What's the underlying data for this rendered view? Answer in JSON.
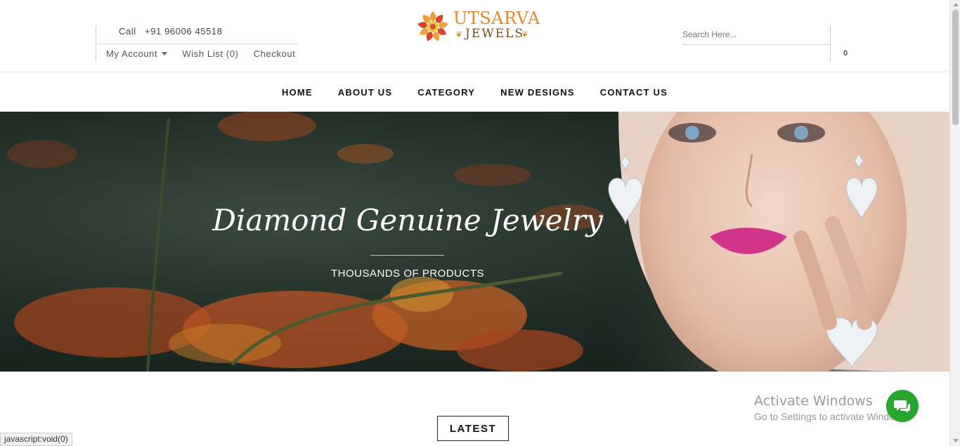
{
  "header": {
    "call_label": "Call",
    "phone": "+91 96006 45518",
    "my_account": "My Account",
    "wish_list": "Wish List (0)",
    "checkout": "Checkout",
    "search_placeholder": "Search Here...",
    "cart_count": "0"
  },
  "logo": {
    "line1": "UTSARVA",
    "line2": "JEWELS"
  },
  "nav": {
    "items": [
      {
        "label": "HOME"
      },
      {
        "label": "ABOUT US"
      },
      {
        "label": "CATEGORY"
      },
      {
        "label": "NEW DESIGNS"
      },
      {
        "label": "CONTACT US"
      }
    ]
  },
  "hero": {
    "title": "Diamond Genuine Jewelry",
    "subtitle": "THOUSANDS OF PRODUCTS"
  },
  "section": {
    "latest": "LATEST"
  },
  "windows": {
    "line1": "Activate Windows",
    "line2": "Go to Settings to activate Windows."
  },
  "status_bar": "javascript:void(0)",
  "colors": {
    "logo_orange": "#e08a2a",
    "logo_brown": "#7a4d1c",
    "chat_green": "#27a62e",
    "lip_pink": "#d0348a"
  }
}
